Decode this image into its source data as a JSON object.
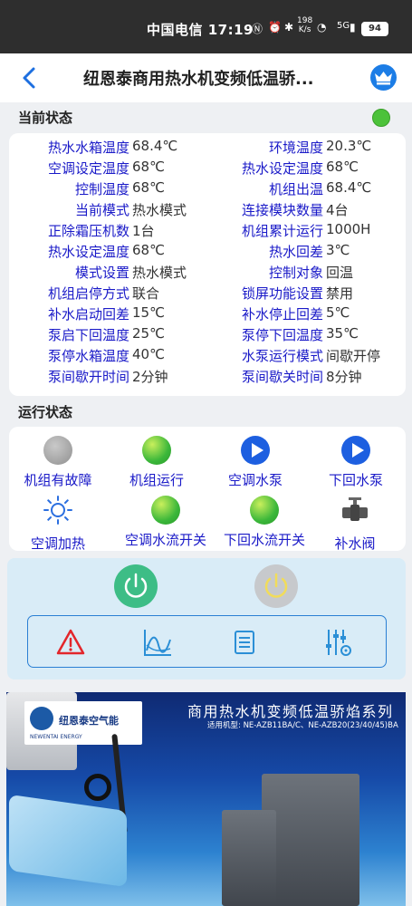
{
  "statusbar": {
    "carrier_time": "中国电信 17:19",
    "speed_value": "198",
    "speed_unit": "K/s",
    "network": "5G",
    "battery": "94"
  },
  "header": {
    "title": "纽恩泰商用热水机变频低温骄..."
  },
  "current_status": {
    "title": "当前状态",
    "rows": [
      {
        "l1": "热水水箱温度",
        "v1": "68.4℃",
        "l2": "环境温度",
        "v2": "20.3℃"
      },
      {
        "l1": "空调设定温度",
        "v1": "68℃",
        "l2": "热水设定温度",
        "v2": "68℃"
      },
      {
        "l1": "控制温度",
        "v1": "68℃",
        "l2": "机组出温",
        "v2": "68.4℃"
      },
      {
        "l1": "当前模式",
        "v1": "热水模式",
        "l2": "连接模块数量",
        "v2": "4台"
      },
      {
        "l1": "正除霜压机数",
        "v1": "1台",
        "l2": "机组累计运行",
        "v2": "1000H"
      },
      {
        "l1": "热水设定温度",
        "v1": "68℃",
        "l2": "热水回差",
        "v2": "3℃"
      },
      {
        "l1": "模式设置",
        "v1": "热水模式",
        "l2": "控制对象",
        "v2": "回温"
      },
      {
        "l1": "机组启停方式",
        "v1": "联合",
        "l2": "锁屏功能设置",
        "v2": "禁用"
      },
      {
        "l1": "补水启动回差",
        "v1": "15℃",
        "l2": "补水停止回差",
        "v2": "5℃"
      },
      {
        "l1": "泵启下回温度",
        "v1": "25℃",
        "l2": "泵停下回温度",
        "v2": "35℃"
      },
      {
        "l1": "泵停水箱温度",
        "v1": "40℃",
        "l2": "水泵运行模式",
        "v2": "间歇开停"
      },
      {
        "l1": "泵间歇开时间",
        "v1": "2分钟",
        "l2": "泵间歇关时间",
        "v2": "8分钟"
      }
    ]
  },
  "run_status": {
    "title": "运行状态",
    "items": [
      {
        "label": "机组有故障",
        "icon": "gray-indicator"
      },
      {
        "label": "机组运行",
        "icon": "green-indicator"
      },
      {
        "label": "空调水泵",
        "icon": "pump-icon"
      },
      {
        "label": "下回水泵",
        "icon": "pump-icon"
      },
      {
        "label": "空调加热",
        "icon": "sun-icon"
      },
      {
        "label": "空调水流开关",
        "icon": "green-indicator"
      },
      {
        "label": "下回水流开关",
        "icon": "green-indicator"
      },
      {
        "label": "补水阀",
        "icon": "valve-icon"
      }
    ]
  },
  "controls": {
    "power_on_color": "#3dbd86",
    "power_off_color": "#c7c9cc",
    "toolbar": [
      "alarm-icon",
      "chart-icon",
      "list-icon",
      "settings-icon"
    ]
  },
  "banner": {
    "brand": "纽恩泰空气能",
    "brand_en": "NEWENTAI ENERGY",
    "title": "商用热水机变频低温骄焰系列",
    "subtitle": "适用机型: NE-AZB11BA/C、NE-AZB20(23/40/45)BA"
  }
}
